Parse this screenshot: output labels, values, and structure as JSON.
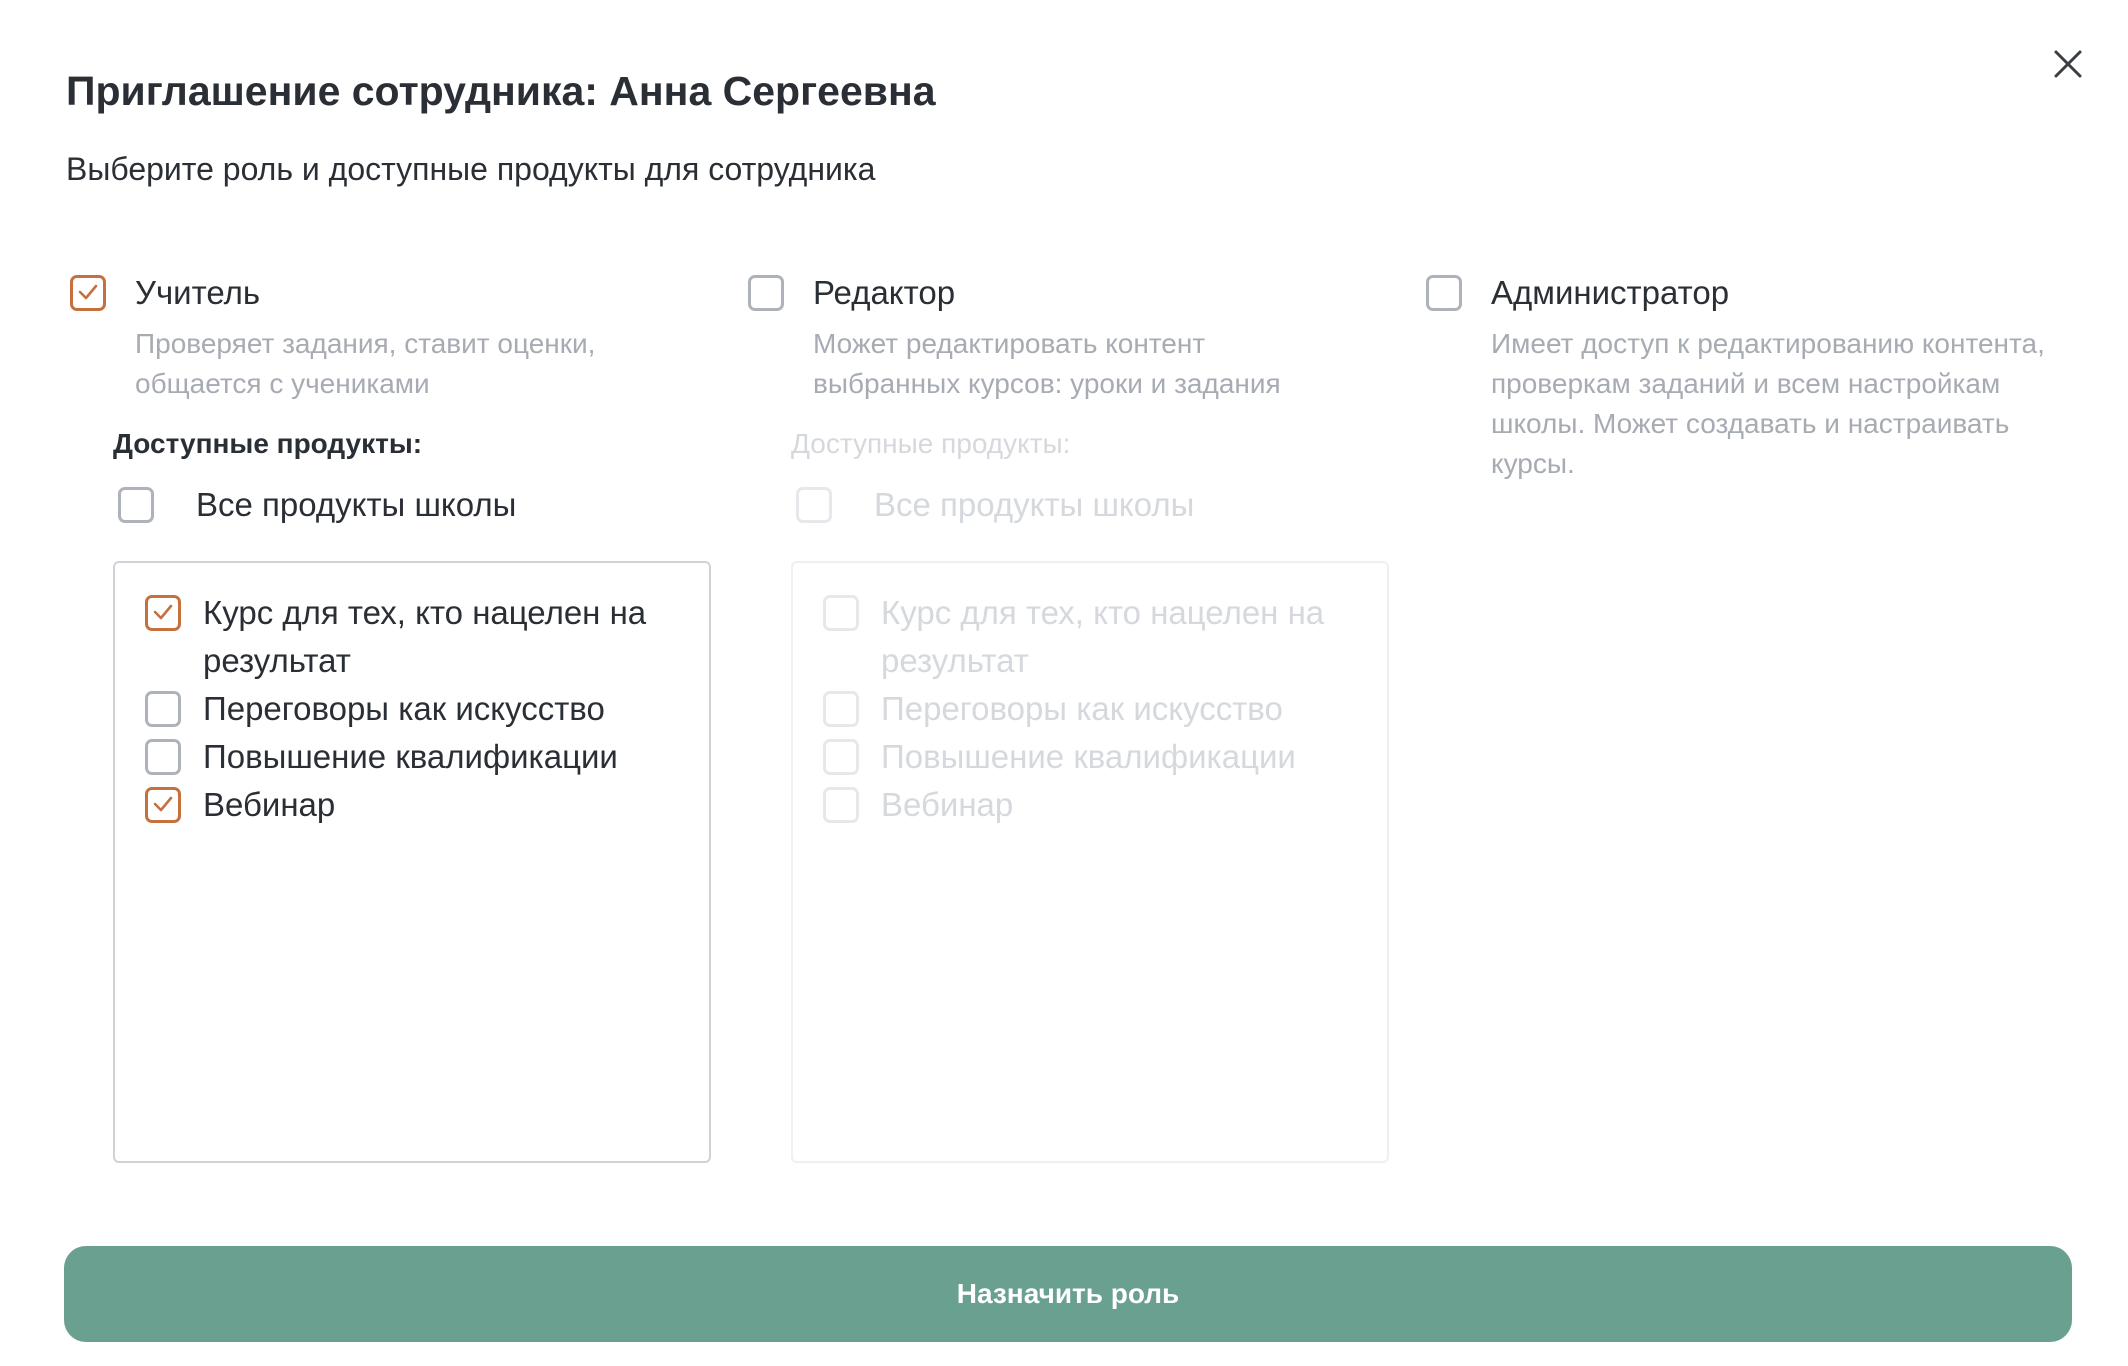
{
  "dialog": {
    "title": "Приглашение сотрудника: Анна Сергеевна",
    "subtitle": "Выберите роль и доступные продукты для сотрудника",
    "close_icon": "close-icon"
  },
  "roles": [
    {
      "name": "Учитель",
      "description": "Проверяет задания, ставит оценки, общается с учениками",
      "checked": true,
      "products_label": "Доступные продукты:",
      "all_products_label": "Все продукты школы",
      "all_products_checked": false,
      "enabled": true,
      "products": [
        {
          "label": "Курс для тех, кто нацелен на результат",
          "checked": true
        },
        {
          "label": "Переговоры как искусство",
          "checked": false
        },
        {
          "label": "Повышение квалификации",
          "checked": false
        },
        {
          "label": "Вебинар",
          "checked": true
        }
      ]
    },
    {
      "name": "Редактор",
      "description": "Может редактировать контент выбранных курсов: уроки и задания",
      "checked": false,
      "products_label": "Доступные продукты:",
      "all_products_label": "Все продукты школы",
      "all_products_checked": false,
      "enabled": false,
      "products": [
        {
          "label": "Курс для тех, кто нацелен на результат",
          "checked": false
        },
        {
          "label": "Переговоры как искусство",
          "checked": false
        },
        {
          "label": "Повышение квалификации",
          "checked": false
        },
        {
          "label": "Вебинар",
          "checked": false
        }
      ]
    },
    {
      "name": "Администратор",
      "description": "Имеет доступ к редактированию контента, проверкам заданий и всем настройкам школы. Может создавать и настраивать курсы.",
      "checked": false
    }
  ],
  "actions": {
    "assign_label": "Назначить роль"
  },
  "colors": {
    "accent_check": "#c5703e",
    "primary_button": "#6aa08f",
    "muted_text": "#a7abb3",
    "disabled_text": "#d5d8dd"
  }
}
